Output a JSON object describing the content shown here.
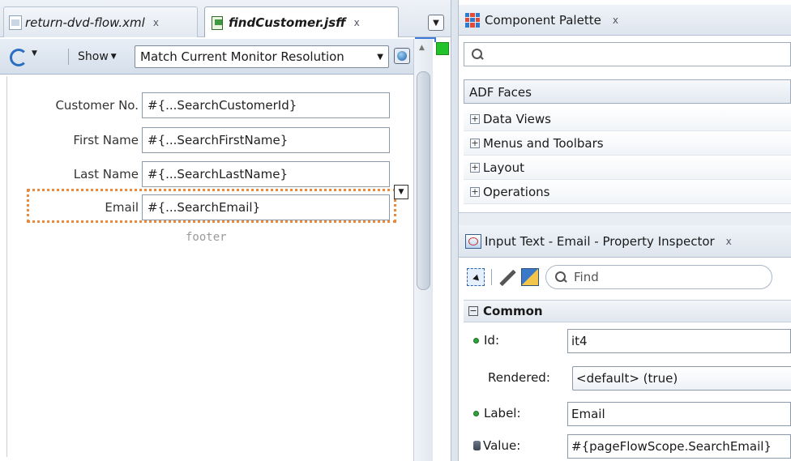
{
  "editor": {
    "tabs": [
      {
        "label": "return-dvd-flow.xml",
        "close": "x",
        "active": false
      },
      {
        "label": "findCustomer.jsff",
        "close": "x",
        "active": true
      }
    ],
    "tab_overflow_icon": "chevron-down-icon",
    "toolbar": {
      "show_label": "Show",
      "resolution_value": "Match Current Monitor Resolution",
      "icons": [
        "refresh-icon",
        "globe-icon"
      ]
    },
    "form": {
      "rows": [
        {
          "label": "Customer No.",
          "value": "#{...SearchCustomerId}"
        },
        {
          "label": "First Name",
          "value": "#{...SearchFirstName}"
        },
        {
          "label": "Last Name",
          "value": "#{...SearchLastName}"
        },
        {
          "label": "Email",
          "value": "#{...SearchEmail}",
          "selected": true
        }
      ],
      "footer_label": "footer"
    },
    "selection_color": "#ea8a3f"
  },
  "palette": {
    "title": "Component Palette",
    "close": "x",
    "search_placeholder": "",
    "library": "ADF Faces",
    "categories": [
      {
        "expander": "+",
        "label": "Data Views"
      },
      {
        "expander": "+",
        "label": "Menus and Toolbars"
      },
      {
        "expander": "+",
        "label": "Layout"
      },
      {
        "expander": "+",
        "label": "Operations"
      }
    ]
  },
  "inspector": {
    "title": "Input Text - Email - Property Inspector",
    "close": "x",
    "find_placeholder": "Find",
    "section": {
      "expander": "−",
      "label": "Common"
    },
    "properties": [
      {
        "label": "Id:",
        "value": "it4",
        "required": true
      },
      {
        "label": "Rendered:",
        "value": "<default> (true)",
        "combo": true
      },
      {
        "label": "Label:",
        "value": "Email",
        "required": true
      },
      {
        "label": "Value:",
        "value": "#{pageFlowScope.SearchEmail}",
        "bound": true
      }
    ]
  }
}
